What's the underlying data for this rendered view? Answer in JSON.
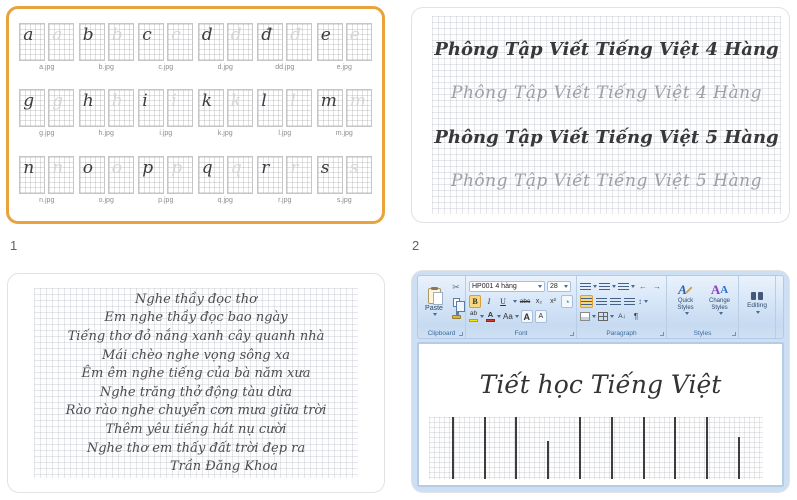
{
  "page": {
    "slide1_number": "1",
    "slide2_number": "2"
  },
  "colors": {
    "selection_accent": "#e8a33d",
    "ribbon_active": "#f9d77e",
    "ink": "#3d3d3d"
  },
  "slide1": {
    "items": [
      {
        "letter": "a",
        "filename": "a.jpg"
      },
      {
        "letter": "b",
        "filename": "b.jpg"
      },
      {
        "letter": "c",
        "filename": "c.jpg"
      },
      {
        "letter": "d",
        "filename": "d.jpg"
      },
      {
        "letter": "đ",
        "filename": "dd.jpg"
      },
      {
        "letter": "e",
        "filename": "e.jpg"
      },
      {
        "letter": "g",
        "filename": "g.jpg"
      },
      {
        "letter": "h",
        "filename": "h.jpg"
      },
      {
        "letter": "i",
        "filename": "i.jpg"
      },
      {
        "letter": "k",
        "filename": "k.jpg"
      },
      {
        "letter": "l",
        "filename": "l.jpg"
      },
      {
        "letter": "m",
        "filename": "m.jpg"
      },
      {
        "letter": "n",
        "filename": "n.jpg"
      },
      {
        "letter": "o",
        "filename": "o.jpg"
      },
      {
        "letter": "p",
        "filename": "p.jpg"
      },
      {
        "letter": "q",
        "filename": "q.jpg"
      },
      {
        "letter": "r",
        "filename": "r.jpg"
      },
      {
        "letter": "s",
        "filename": "s.jpg"
      }
    ]
  },
  "slide2": {
    "lines": [
      {
        "text": "Phông Tập Viết Tiếng Việt 4 Hàng",
        "style": "solid"
      },
      {
        "text": "Phông Tập Viết Tiếng Việt 4 Hàng",
        "style": "outline"
      },
      {
        "text": "Phông Tập Viết Tiếng Việt 5 Hàng",
        "style": "solid"
      },
      {
        "text": "Phông Tập Viết Tiếng Việt 5 Hàng",
        "style": "outline"
      }
    ]
  },
  "slide3": {
    "poem_lines": [
      "Nghe thầy đọc thơ",
      "Em nghe thầy đọc bao ngày",
      "Tiếng thơ đỏ nắng xanh cây quanh nhà",
      "Mái chèo nghe vọng sông xa",
      "Êm êm nghe tiếng của bà năm xưa",
      "Nghe trăng thở động tàu dừa",
      "Rào rào nghe chuyển cơn mưa giữa trời",
      "Thêm yêu tiếng hát nụ cười",
      "Nghe thơ em thấy đất trời đẹp ra",
      "Trần Đăng Khoa"
    ]
  },
  "slide4": {
    "ribbon": {
      "clipboard": {
        "paste_label": "Paste",
        "cut_glyph": "✂",
        "group_label": "Clipboard"
      },
      "font": {
        "name_value": "HP001 4 hàng",
        "size_value": "28",
        "bold": "B",
        "italic": "I",
        "underline": "U",
        "strikethrough": "abc",
        "subscript": "x₂",
        "superscript": "x²",
        "change_case": "Aa",
        "highlight_glyph": "ab",
        "color_glyph": "A",
        "grow_glyph": "A",
        "shrink_glyph": "A",
        "phonetic_glyph": "◔",
        "group_label": "Font"
      },
      "paragraph": {
        "outdent_glyph": "←",
        "indent_glyph": "→",
        "spacing_glyph": "↕",
        "sort_glyph": "A↓",
        "pilcrow": "¶",
        "group_label": "Paragraph"
      },
      "styles": {
        "quick_glyph": "A",
        "change_glyph_1": "A",
        "change_glyph_2": "A",
        "quick_label": "Quick Styles",
        "change_label": "Change Styles",
        "group_label": "Styles"
      },
      "editing": {
        "label": "Editing"
      }
    },
    "document": {
      "title": "Tiết học Tiếng Việt",
      "bars": [
        {
          "h": 100
        },
        {
          "h": 100
        },
        {
          "h": 100
        },
        {
          "h": 62
        },
        {
          "h": 100
        },
        {
          "h": 100
        },
        {
          "h": 100
        },
        {
          "h": 100
        },
        {
          "h": 100
        },
        {
          "h": 68
        }
      ]
    }
  }
}
